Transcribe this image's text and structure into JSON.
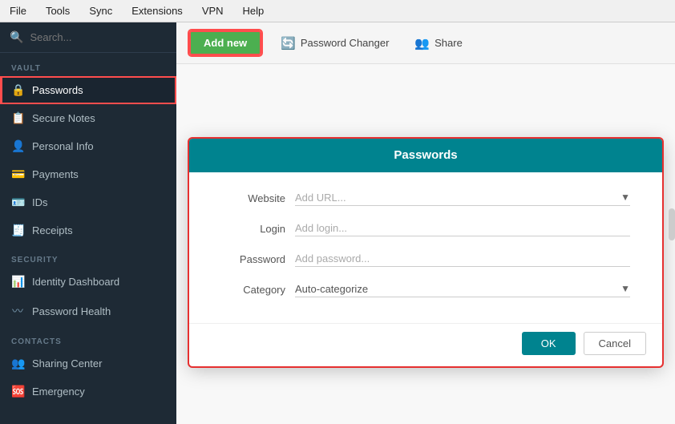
{
  "menubar": {
    "items": [
      "File",
      "Tools",
      "Sync",
      "Extensions",
      "VPN",
      "Help"
    ]
  },
  "sidebar": {
    "search_placeholder": "Search...",
    "sections": [
      {
        "label": "VAULT",
        "items": [
          {
            "id": "passwords",
            "icon": "🔒",
            "text": "Passwords",
            "active": true
          },
          {
            "id": "secure-notes",
            "icon": "📋",
            "text": "Secure Notes",
            "active": false
          },
          {
            "id": "personal-info",
            "icon": "👤",
            "text": "Personal Info",
            "active": false
          },
          {
            "id": "payments",
            "icon": "💳",
            "text": "Payments",
            "active": false
          },
          {
            "id": "ids",
            "icon": "🪪",
            "text": "IDs",
            "active": false
          },
          {
            "id": "receipts",
            "icon": "🧾",
            "text": "Receipts",
            "active": false
          }
        ]
      },
      {
        "label": "SECURITY",
        "items": [
          {
            "id": "identity-dashboard",
            "icon": "📊",
            "text": "Identity Dashboard",
            "active": false
          },
          {
            "id": "password-health",
            "icon": "〰",
            "text": "Password Health",
            "active": false
          }
        ]
      },
      {
        "label": "CONTACTS",
        "items": [
          {
            "id": "sharing-center",
            "icon": "👥",
            "text": "Sharing Center",
            "active": false
          },
          {
            "id": "emergency",
            "icon": "🆘",
            "text": "Emergency",
            "active": false
          }
        ]
      }
    ]
  },
  "toolbar": {
    "add_new_label": "Add new",
    "password_changer_label": "Password Changer",
    "share_label": "Share"
  },
  "modal": {
    "title": "Passwords",
    "fields": [
      {
        "label": "Website",
        "placeholder": "Add URL...",
        "has_dropdown": true
      },
      {
        "label": "Login",
        "placeholder": "Add login...",
        "has_dropdown": false
      },
      {
        "label": "Password",
        "placeholder": "Add password...",
        "has_dropdown": false
      },
      {
        "label": "Category",
        "value": "Auto-categorize",
        "has_dropdown": true
      }
    ],
    "ok_label": "OK",
    "cancel_label": "Cancel"
  },
  "icons": {
    "search": "🔍",
    "password_changer": "🔄",
    "share": "👥",
    "chevron_down": "▼"
  }
}
